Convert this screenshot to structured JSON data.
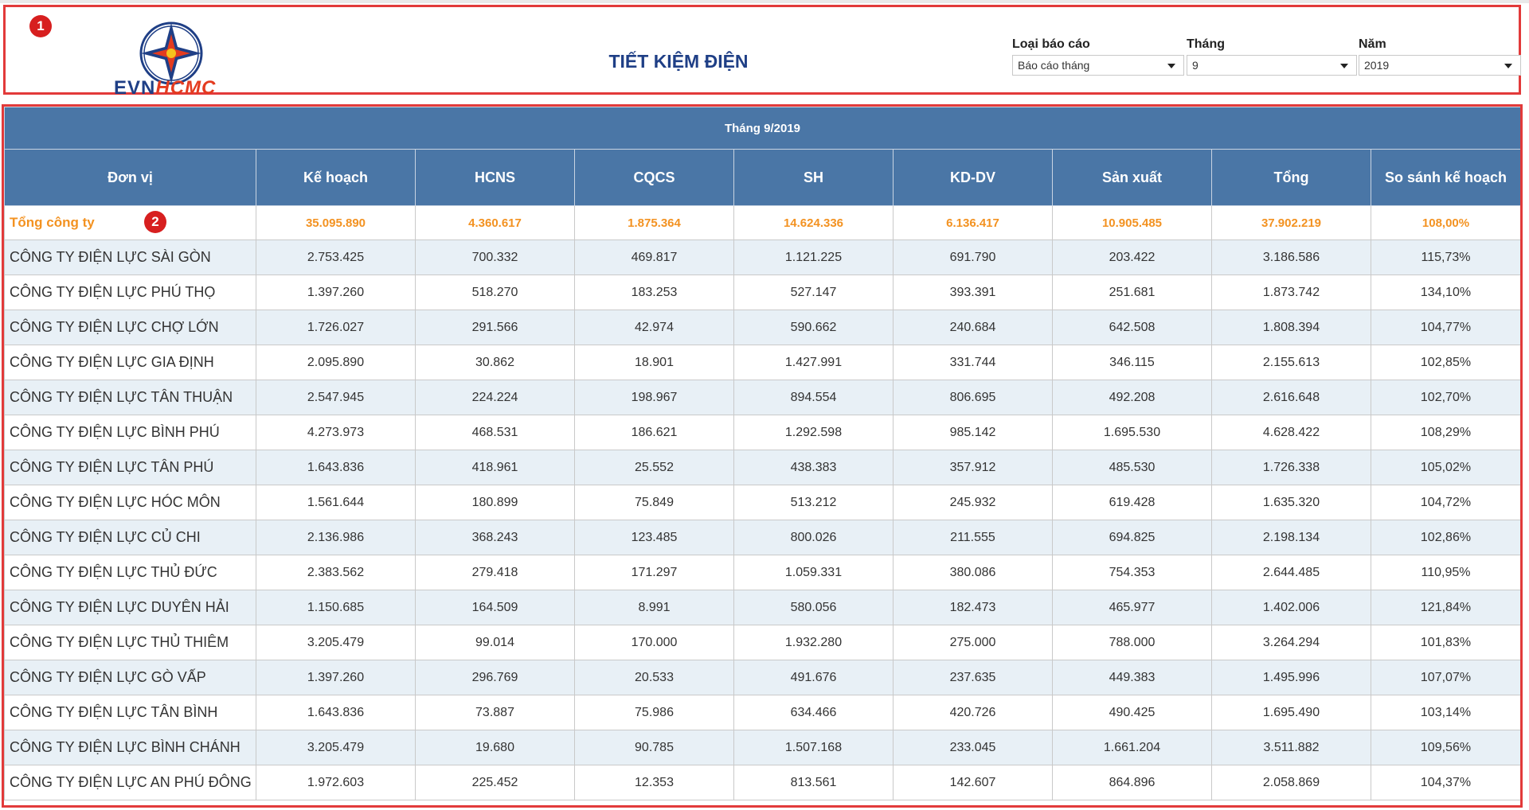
{
  "header": {
    "logo_text_evn": "EVN",
    "logo_text_hcmc": "HCMC",
    "title": "TIẾT KIỆM ĐIỆN",
    "badge_1": "1",
    "badge_2": "2",
    "filters": {
      "report_type": {
        "label": "Loại báo cáo",
        "value": "Báo cáo tháng"
      },
      "month": {
        "label": "Tháng",
        "value": "9"
      },
      "year": {
        "label": "Năm",
        "value": "2019"
      }
    }
  },
  "colors": {
    "brand_blue": "#1f3f86",
    "brand_red": "#e43b1f",
    "header_bg": "#4a76a6",
    "total_text": "#f39221",
    "stripe": "#e8f0f6",
    "highlight_border": "#e23a3a"
  },
  "table": {
    "period_title": "Tháng 9/2019",
    "columns": [
      "Đơn vị",
      "Kế hoạch",
      "HCNS",
      "CQCS",
      "SH",
      "KD-DV",
      "Sản xuất",
      "Tổng",
      "So sánh kế hoạch"
    ],
    "total": [
      "Tổng công ty",
      "35.095.890",
      "4.360.617",
      "1.875.364",
      "14.624.336",
      "6.136.417",
      "10.905.485",
      "37.902.219",
      "108,00%"
    ],
    "rows": [
      [
        "CÔNG TY ĐIỆN LỰC SÀI GÒN",
        "2.753.425",
        "700.332",
        "469.817",
        "1.121.225",
        "691.790",
        "203.422",
        "3.186.586",
        "115,73%"
      ],
      [
        "CÔNG TY ĐIỆN LỰC PHÚ THỌ",
        "1.397.260",
        "518.270",
        "183.253",
        "527.147",
        "393.391",
        "251.681",
        "1.873.742",
        "134,10%"
      ],
      [
        "CÔNG TY ĐIỆN LỰC CHỢ LỚN",
        "1.726.027",
        "291.566",
        "42.974",
        "590.662",
        "240.684",
        "642.508",
        "1.808.394",
        "104,77%"
      ],
      [
        "CÔNG TY ĐIỆN LỰC GIA ĐỊNH",
        "2.095.890",
        "30.862",
        "18.901",
        "1.427.991",
        "331.744",
        "346.115",
        "2.155.613",
        "102,85%"
      ],
      [
        "CÔNG TY ĐIỆN LỰC TÂN THUẬN",
        "2.547.945",
        "224.224",
        "198.967",
        "894.554",
        "806.695",
        "492.208",
        "2.616.648",
        "102,70%"
      ],
      [
        "CÔNG TY ĐIỆN LỰC BÌNH PHÚ",
        "4.273.973",
        "468.531",
        "186.621",
        "1.292.598",
        "985.142",
        "1.695.530",
        "4.628.422",
        "108,29%"
      ],
      [
        "CÔNG TY ĐIỆN LỰC TÂN PHÚ",
        "1.643.836",
        "418.961",
        "25.552",
        "438.383",
        "357.912",
        "485.530",
        "1.726.338",
        "105,02%"
      ],
      [
        "CÔNG TY ĐIỆN LỰC HÓC MÔN",
        "1.561.644",
        "180.899",
        "75.849",
        "513.212",
        "245.932",
        "619.428",
        "1.635.320",
        "104,72%"
      ],
      [
        "CÔNG TY ĐIỆN LỰC CỦ CHI",
        "2.136.986",
        "368.243",
        "123.485",
        "800.026",
        "211.555",
        "694.825",
        "2.198.134",
        "102,86%"
      ],
      [
        "CÔNG TY ĐIỆN LỰC THỦ ĐỨC",
        "2.383.562",
        "279.418",
        "171.297",
        "1.059.331",
        "380.086",
        "754.353",
        "2.644.485",
        "110,95%"
      ],
      [
        "CÔNG TY ĐIỆN LỰC DUYÊN HẢI",
        "1.150.685",
        "164.509",
        "8.991",
        "580.056",
        "182.473",
        "465.977",
        "1.402.006",
        "121,84%"
      ],
      [
        "CÔNG TY ĐIỆN LỰC THỦ THIÊM",
        "3.205.479",
        "99.014",
        "170.000",
        "1.932.280",
        "275.000",
        "788.000",
        "3.264.294",
        "101,83%"
      ],
      [
        "CÔNG TY ĐIỆN LỰC GÒ VẤP",
        "1.397.260",
        "296.769",
        "20.533",
        "491.676",
        "237.635",
        "449.383",
        "1.495.996",
        "107,07%"
      ],
      [
        "CÔNG TY ĐIỆN LỰC TÂN BÌNH",
        "1.643.836",
        "73.887",
        "75.986",
        "634.466",
        "420.726",
        "490.425",
        "1.695.490",
        "103,14%"
      ],
      [
        "CÔNG TY ĐIỆN LỰC BÌNH CHÁNH",
        "3.205.479",
        "19.680",
        "90.785",
        "1.507.168",
        "233.045",
        "1.661.204",
        "3.511.882",
        "109,56%"
      ],
      [
        "CÔNG TY ĐIỆN LỰC AN PHÚ ĐÔNG",
        "1.972.603",
        "225.452",
        "12.353",
        "813.561",
        "142.607",
        "864.896",
        "2.058.869",
        "104,37%"
      ]
    ]
  }
}
